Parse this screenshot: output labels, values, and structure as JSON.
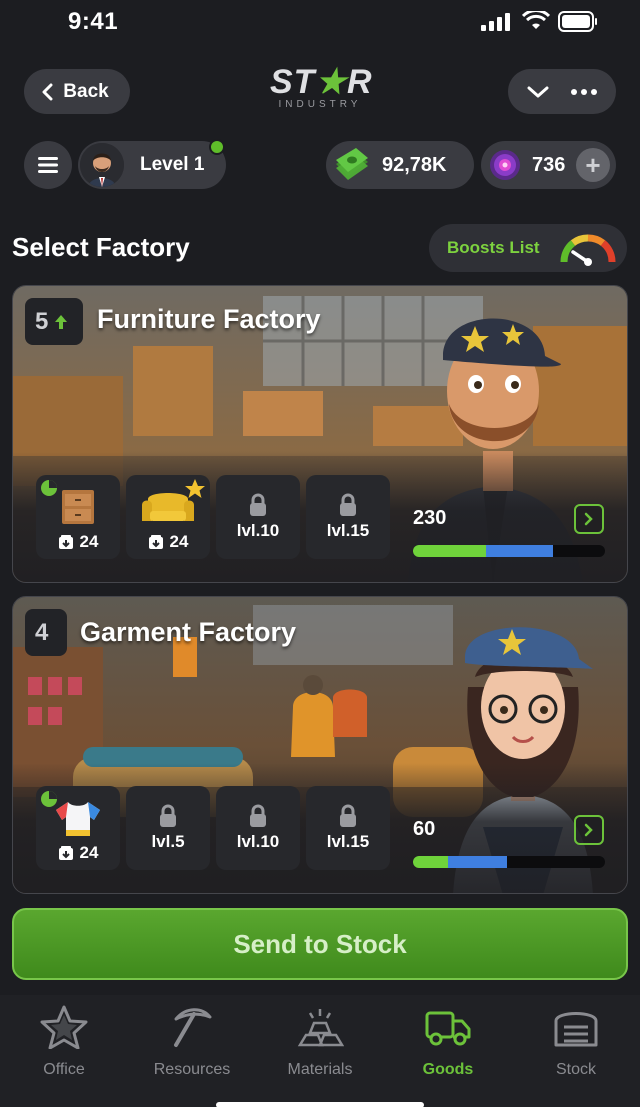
{
  "status_bar": {
    "time": "9:41"
  },
  "header": {
    "back_label": "Back",
    "logo_word_a": "ST",
    "logo_word_b": "R",
    "logo_sub": "INDUSTRY"
  },
  "player": {
    "level_label": "Level 1",
    "cash": "92,78K",
    "gems": "736",
    "plus_label": "+"
  },
  "section": {
    "title": "Select Factory",
    "boosts_label": "Boosts List"
  },
  "factories": [
    {
      "level": "5",
      "name": "Furniture Factory",
      "slots": [
        {
          "type": "item",
          "icon": "dresser-icon",
          "count": "24",
          "timer": true,
          "star": false
        },
        {
          "type": "item",
          "icon": "armchair-icon",
          "count": "24",
          "timer": false,
          "star": true
        },
        {
          "type": "locked",
          "label": "lvl.10"
        },
        {
          "type": "locked",
          "label": "lvl.15"
        }
      ],
      "stat": "230",
      "progress": {
        "green": 0.38,
        "blue": 0.35
      }
    },
    {
      "level": "4",
      "name": "Garment Factory",
      "slots": [
        {
          "type": "item",
          "icon": "tshirt-icon",
          "count": "24",
          "timer": true,
          "star": false
        },
        {
          "type": "locked",
          "label": "lvl.5"
        },
        {
          "type": "locked",
          "label": "lvl.10"
        },
        {
          "type": "locked",
          "label": "lvl.15"
        }
      ],
      "stat": "60",
      "progress": {
        "green": 0.18,
        "blue": 0.31
      }
    }
  ],
  "send_button": "Send to Stock",
  "tabs": [
    {
      "label": "Office",
      "icon": "star-icon",
      "active": false
    },
    {
      "label": "Resources",
      "icon": "pickaxe-icon",
      "active": false
    },
    {
      "label": "Materials",
      "icon": "ingots-icon",
      "active": false
    },
    {
      "label": "Goods",
      "icon": "truck-icon",
      "active": true
    },
    {
      "label": "Stock",
      "icon": "warehouse-icon",
      "active": false
    }
  ],
  "colors": {
    "accent": "#6cc23a",
    "background": "#1c1d21",
    "pill": "#3a3b41"
  }
}
